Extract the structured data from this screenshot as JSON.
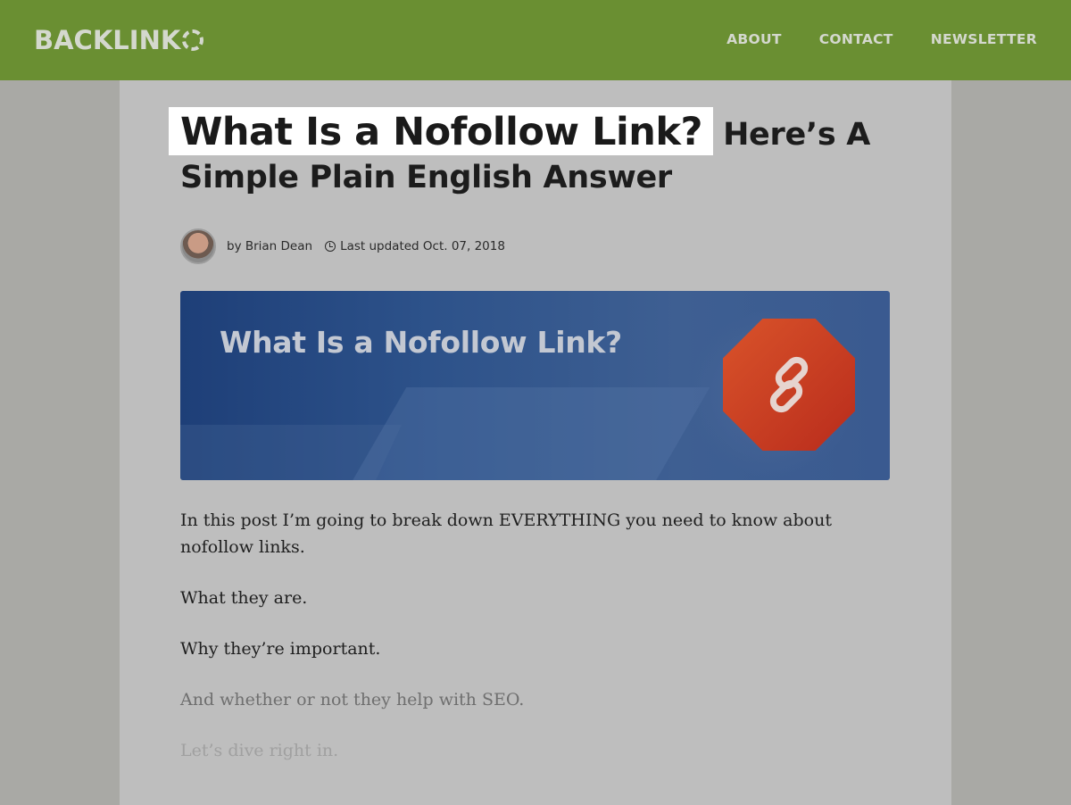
{
  "header": {
    "logo_text": "BACKLINK",
    "nav": [
      "ABOUT",
      "CONTACT",
      "NEWSLETTER"
    ]
  },
  "article": {
    "title_highlight": "What Is a Nofollow Link?",
    "title_rest": "Here’s A Simple Plain English Answer",
    "author": "by Brian Dean",
    "updated": "Last updated Oct. 07, 2018",
    "hero_title": "What Is a Nofollow Link?",
    "paragraphs": [
      "In this post I’m going to break down EVERYTHING you need to know about nofollow links.",
      "What they are.",
      "Why they’re important.",
      "And whether or not they help with SEO.",
      "Let’s dive right in."
    ]
  },
  "colors": {
    "header_bg": "#6a8f32",
    "page_bg": "#a9a9a5",
    "content_bg": "#bebebe",
    "highlight_bg": "#ffffff"
  },
  "icons": [
    "clock-icon",
    "chain-link-icon",
    "avatar"
  ]
}
